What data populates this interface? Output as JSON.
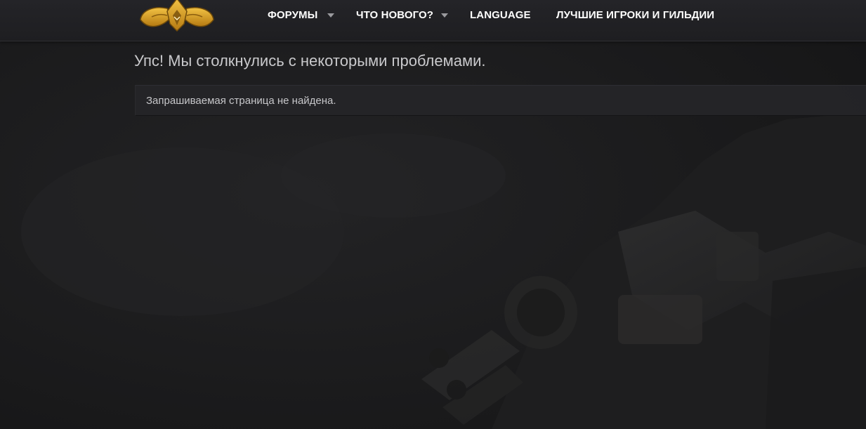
{
  "header": {
    "logo_name": "guild-logo",
    "nav": [
      {
        "label": "ФОРУМЫ",
        "has_dropdown": true
      },
      {
        "label": "ЧТО НОВОГО?",
        "has_dropdown": true
      },
      {
        "label": "LANGUAGE",
        "has_dropdown": false
      },
      {
        "label": "ЛУЧШИЕ ИГРОКИ И ГИЛЬДИИ",
        "has_dropdown": false
      }
    ]
  },
  "main": {
    "title": "Упс! Мы столкнулись с некоторыми проблемами.",
    "error_message": "Запрашиваемая страница не найдена."
  },
  "colors": {
    "background": "#1d1d1f",
    "header": "#242428",
    "logo_gold": "#d8a21f",
    "nav_text": "#ffffff",
    "title_text": "#c9c9cc",
    "notice_bg": "#242428"
  }
}
